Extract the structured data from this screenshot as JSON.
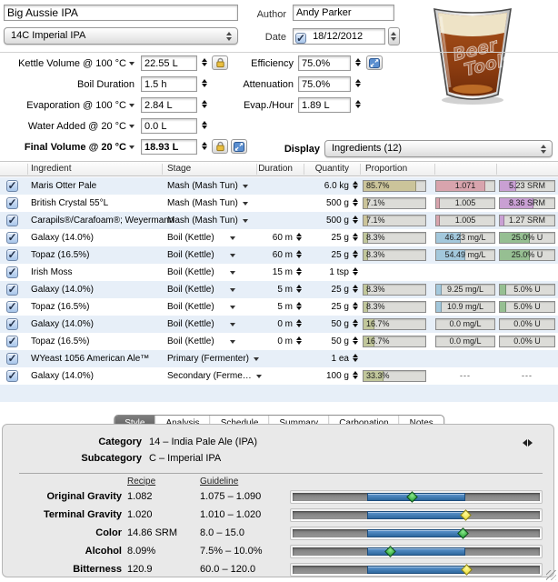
{
  "colors": {
    "tan": "#cbc49a",
    "hop": "#c1c79b",
    "pink": "#d8a4ad",
    "violet": "#c9a0d3",
    "blue": "#a3c8dc",
    "green": "#96bf92"
  },
  "top": {
    "recipe_name": "Big Aussie IPA",
    "style_popup": "14C Imperial IPA",
    "author_label": "Author",
    "author_value": "Andy Parker",
    "date_label": "Date",
    "date_value": "18/12/2012",
    "date_checked": true,
    "glass_logo_line1": "Beer",
    "glass_logo_line2": "Tools"
  },
  "params_left": [
    {
      "label": "Kettle Volume @ 100 °C",
      "unit_arrow": true,
      "bold": false,
      "value": "22.55 L",
      "icons": [
        "lock"
      ]
    },
    {
      "label": "Boil Duration",
      "unit_arrow": false,
      "bold": false,
      "value": "1.5 h",
      "icons": []
    },
    {
      "label": "Evaporation @ 100 °C",
      "unit_arrow": true,
      "bold": false,
      "value": "2.84 L",
      "icons": []
    },
    {
      "label": "Water Added @ 20 °C",
      "unit_arrow": true,
      "bold": false,
      "value": "0.0 L",
      "icons": []
    },
    {
      "label": "Final Volume @ 20 °C",
      "unit_arrow": true,
      "bold": true,
      "value": "18.93 L",
      "icons": [
        "lock",
        "scale"
      ]
    }
  ],
  "params_right": [
    {
      "label": "Efficiency",
      "unit_arrow": false,
      "bold": false,
      "value": "75.0%",
      "icons": [
        "scale"
      ]
    },
    {
      "label": "Attenuation",
      "unit_arrow": false,
      "bold": false,
      "value": "75.0%",
      "icons": []
    },
    {
      "label": "Evap./Hour",
      "unit_arrow": false,
      "bold": false,
      "value": "1.89 L",
      "icons": []
    }
  ],
  "display": {
    "label": "Display",
    "value": "Ingredients (12)"
  },
  "table": {
    "headers": [
      "Ingredient",
      "Stage",
      "Duration",
      "Quantity",
      "Proportion"
    ],
    "rows": [
      {
        "checked": true,
        "ingredient": "Maris Otter Pale",
        "stage": "Mash (Mash Tun)",
        "stage_gap": false,
        "duration": "",
        "quantity": "6.0 kg",
        "prop": {
          "text": "85.7%",
          "fill": 0.86,
          "color": "tan"
        },
        "mid": {
          "text": "1.071",
          "fill": 0.85,
          "color": "pink"
        },
        "right": {
          "text": "5.23 SRM",
          "fill": 0.3,
          "color": "violet"
        }
      },
      {
        "checked": true,
        "ingredient": "British Crystal 55°L",
        "stage": "Mash (Mash Tun)",
        "stage_gap": false,
        "duration": "",
        "quantity": "500 g",
        "prop": {
          "text": "7.1%",
          "fill": 0.07,
          "color": "tan"
        },
        "mid": {
          "text": "1.005",
          "fill": 0.06,
          "color": "pink"
        },
        "right": {
          "text": "8.36 SRM",
          "fill": 0.62,
          "color": "violet"
        }
      },
      {
        "checked": true,
        "ingredient": "Carapils®/Carafoam®; Weyermann",
        "stage": "Mash (Mash Tun)",
        "stage_gap": false,
        "duration": "",
        "quantity": "500 g",
        "prop": {
          "text": "7.1%",
          "fill": 0.07,
          "color": "tan"
        },
        "mid": {
          "text": "1.005",
          "fill": 0.06,
          "color": "pink"
        },
        "right": {
          "text": "1.27 SRM",
          "fill": 0.09,
          "color": "violet"
        }
      },
      {
        "checked": true,
        "ingredient": "Galaxy (14.0%)",
        "stage": "Boil (Kettle)",
        "stage_gap": true,
        "duration": "60 m",
        "quantity": "25 g",
        "prop": {
          "text": "8.3%",
          "fill": 0.08,
          "color": "hop"
        },
        "mid": {
          "text": "46.23 mg/L",
          "fill": 0.42,
          "color": "blue"
        },
        "right": {
          "text": "25.0% U",
          "fill": 0.55,
          "color": "green"
        }
      },
      {
        "checked": true,
        "ingredient": "Topaz (16.5%)",
        "stage": "Boil (Kettle)",
        "stage_gap": true,
        "duration": "60 m",
        "quantity": "25 g",
        "prop": {
          "text": "8.3%",
          "fill": 0.08,
          "color": "hop"
        },
        "mid": {
          "text": "54.49 mg/L",
          "fill": 0.5,
          "color": "blue"
        },
        "right": {
          "text": "25.0% U",
          "fill": 0.55,
          "color": "green"
        }
      },
      {
        "checked": true,
        "ingredient": "Irish Moss",
        "stage": "Boil (Kettle)",
        "stage_gap": true,
        "duration": "15 m",
        "quantity": "1 tsp",
        "prop": null,
        "mid": null,
        "right": null
      },
      {
        "checked": true,
        "ingredient": "Galaxy (14.0%)",
        "stage": "Boil (Kettle)",
        "stage_gap": true,
        "duration": "5 m",
        "quantity": "25 g",
        "prop": {
          "text": "8.3%",
          "fill": 0.08,
          "color": "hop"
        },
        "mid": {
          "text": "9.25 mg/L",
          "fill": 0.09,
          "color": "blue"
        },
        "right": {
          "text": "5.0% U",
          "fill": 0.11,
          "color": "green"
        }
      },
      {
        "checked": true,
        "ingredient": "Topaz (16.5%)",
        "stage": "Boil (Kettle)",
        "stage_gap": true,
        "duration": "5 m",
        "quantity": "25 g",
        "prop": {
          "text": "8.3%",
          "fill": 0.08,
          "color": "hop"
        },
        "mid": {
          "text": "10.9 mg/L",
          "fill": 0.1,
          "color": "blue"
        },
        "right": {
          "text": "5.0% U",
          "fill": 0.11,
          "color": "green"
        }
      },
      {
        "checked": true,
        "ingredient": "Galaxy (14.0%)",
        "stage": "Boil (Kettle)",
        "stage_gap": true,
        "duration": "0 m",
        "quantity": "50 g",
        "prop": {
          "text": "16.7%",
          "fill": 0.17,
          "color": "hop"
        },
        "mid": {
          "text": "0.0 mg/L",
          "fill": 0.0,
          "color": "blue"
        },
        "right": {
          "text": "0.0% U",
          "fill": 0.0,
          "color": "green"
        }
      },
      {
        "checked": true,
        "ingredient": "Topaz (16.5%)",
        "stage": "Boil (Kettle)",
        "stage_gap": true,
        "duration": "0 m",
        "quantity": "50 g",
        "prop": {
          "text": "16.7%",
          "fill": 0.17,
          "color": "hop"
        },
        "mid": {
          "text": "0.0 mg/L",
          "fill": 0.0,
          "color": "blue"
        },
        "right": {
          "text": "0.0% U",
          "fill": 0.0,
          "color": "green"
        }
      },
      {
        "checked": true,
        "ingredient": "WYeast 1056 American Ale™",
        "stage": "Primary (Fermenter)",
        "stage_gap": false,
        "duration": "",
        "quantity": "1 ea",
        "prop": null,
        "mid": null,
        "right": null
      },
      {
        "checked": true,
        "ingredient": "Galaxy (14.0%)",
        "stage": "Secondary (Ferme…",
        "stage_gap": false,
        "duration": "",
        "quantity": "100 g",
        "prop": {
          "text": "33.3%",
          "fill": 0.33,
          "color": "hop"
        },
        "mid": {
          "dash": "---"
        },
        "right": {
          "dash": "---"
        }
      }
    ]
  },
  "tabs": {
    "items": [
      "Style",
      "Analysis",
      "Schedule",
      "Summary",
      "Carbonation",
      "Notes"
    ],
    "selected": "Style"
  },
  "style_panel": {
    "category_label": "Category",
    "category": "14 – India Pale Ale (IPA)",
    "subcategory_label": "Subcategory",
    "subcategory": "C – Imperial IPA",
    "recipe_header": "Recipe",
    "guideline_header": "Guideline",
    "range_pct": {
      "start": 30,
      "end": 70
    },
    "metrics": [
      {
        "label": "Original Gravity",
        "recipe": "1.082",
        "guideline": "1.075 – 1.090",
        "marker_pct": 48.5,
        "marker": "green"
      },
      {
        "label": "Terminal Gravity",
        "recipe": "1.020",
        "guideline": "1.010 – 1.020",
        "marker_pct": 70.0,
        "marker": "yellow"
      },
      {
        "label": "Color",
        "recipe": "14.86 SRM",
        "guideline": "8.0 – 15.0",
        "marker_pct": 69.0,
        "marker": "green"
      },
      {
        "label": "Alcohol",
        "recipe": "8.09%",
        "guideline": "7.5% – 10.0%",
        "marker_pct": 39.5,
        "marker": "green"
      },
      {
        "label": "Bitterness",
        "recipe": "120.9",
        "guideline": "60.0 – 120.0",
        "marker_pct": 70.5,
        "marker": "yellow"
      }
    ]
  }
}
